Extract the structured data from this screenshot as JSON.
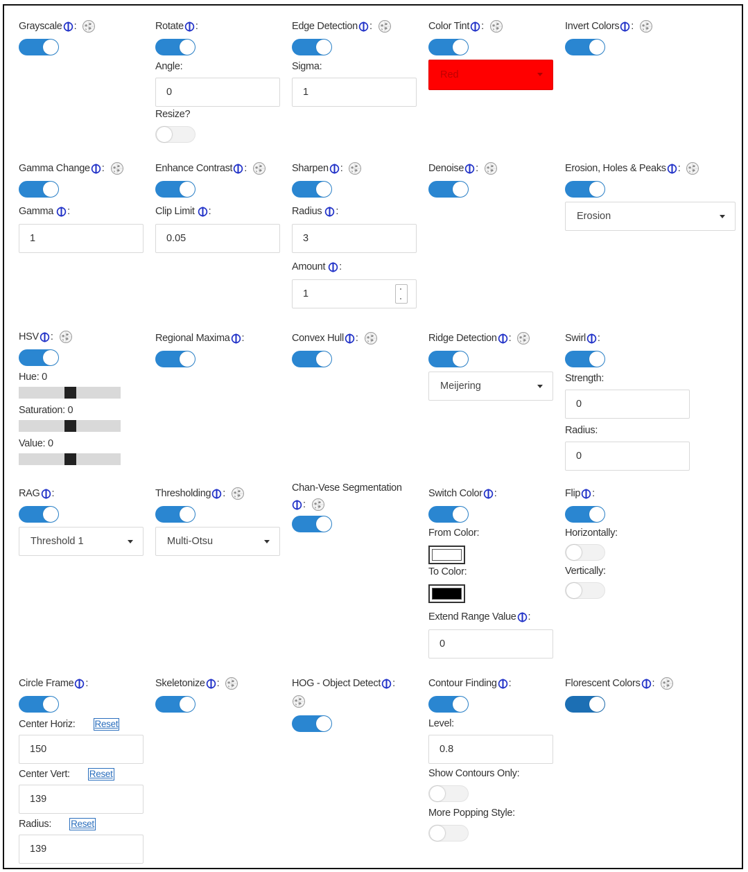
{
  "colors": {
    "accent": "#2a86d1",
    "tint_red": "#ff0000"
  },
  "row1": {
    "grayscale": {
      "label": "Grayscale"
    },
    "rotate": {
      "label": "Rotate",
      "angle_label": "Angle:",
      "angle_value": "0",
      "resize_label": "Resize?"
    },
    "edge": {
      "label": "Edge Detection",
      "sigma_label": "Sigma:",
      "sigma_value": "1"
    },
    "tint": {
      "label": "Color Tint",
      "selected": "Red"
    },
    "invert": {
      "label": "Invert Colors"
    }
  },
  "row2": {
    "gamma": {
      "label": "Gamma Change",
      "field_label": "Gamma",
      "value": "1"
    },
    "contrast": {
      "label": "Enhance Contrast",
      "field_label": "Clip Limit",
      "value": "0.05"
    },
    "sharpen": {
      "label": "Sharpen",
      "radius_label": "Radius",
      "radius_value": "3",
      "amount_label": "Amount",
      "amount_value": "1"
    },
    "denoise": {
      "label": "Denoise"
    },
    "erosion": {
      "label": "Erosion, Holes & Peaks",
      "selected": "Erosion"
    }
  },
  "row3": {
    "hsv": {
      "label": "HSV",
      "hue_label": "Hue: 0",
      "sat_label": "Saturation: 0",
      "val_label": "Value: 0"
    },
    "regional": {
      "label": "Regional Maxima"
    },
    "convex": {
      "label": "Convex Hull"
    },
    "ridge": {
      "label": "Ridge Detection",
      "selected": "Meijering"
    },
    "swirl": {
      "label": "Swirl",
      "strength_label": "Strength:",
      "strength_value": "0",
      "radius_label": "Radius:",
      "radius_value": "0"
    }
  },
  "row4": {
    "rag": {
      "label": "RAG",
      "selected": "Threshold 1"
    },
    "threshold": {
      "label": "Thresholding",
      "selected": "Multi-Otsu"
    },
    "chanvese": {
      "label": "Chan-Vese Segmentation"
    },
    "switch": {
      "label": "Switch Color",
      "from_label": "From Color:",
      "to_label": "To Color:",
      "extend_label": "Extend Range Value",
      "extend_value": "0"
    },
    "flip": {
      "label": "Flip",
      "horiz_label": "Horizontally:",
      "vert_label": "Vertically:"
    }
  },
  "row5": {
    "circle": {
      "label": "Circle Frame",
      "center_h_label": "Center Horiz:",
      "center_h_value": "150",
      "center_v_label": "Center Vert:",
      "center_v_value": "139",
      "radius_label": "Radius:",
      "radius_value": "139",
      "reset_label": "Reset"
    },
    "skeleton": {
      "label": "Skeletonize"
    },
    "hog": {
      "label": "HOG - Object Detect"
    },
    "contour": {
      "label": "Contour Finding",
      "level_label": "Level:",
      "level_value": "0.8",
      "show_label": "Show Contours Only:",
      "popping_label": "More Popping Style:"
    },
    "florescent": {
      "label": "Florescent Colors"
    }
  },
  "icons": {
    "info": "info-icon",
    "wiki": "wikipedia-globe-icon"
  }
}
